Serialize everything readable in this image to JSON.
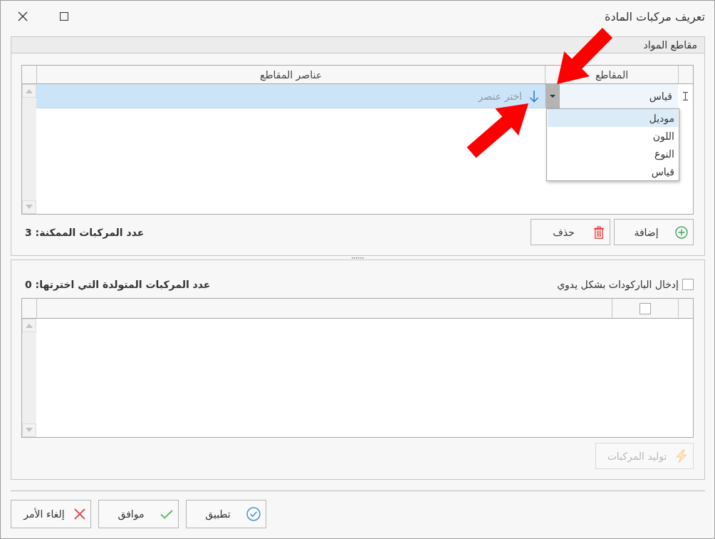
{
  "window": {
    "title": "تعريف مركبات المادة"
  },
  "segments_group": {
    "title": "مقاطع المواد",
    "table": {
      "columns": [
        "المقاطع",
        "عناصر المقاطع"
      ],
      "rows": [
        {
          "segment": "قياس",
          "elements": {
            "placeholder": "اختر عنصر"
          },
          "selected": true
        }
      ]
    },
    "segment_dropdown": {
      "items": [
        {
          "label": "موديل",
          "selected": true
        },
        {
          "label": "اللون",
          "selected": false
        },
        {
          "label": "النوع",
          "selected": false
        },
        {
          "label": "قياس",
          "selected": false
        }
      ]
    },
    "count_label": "عدد المركبات الممكنة: 3",
    "buttons": [
      {
        "label": "إضافة",
        "kind": "add"
      },
      {
        "label": "حذف",
        "kind": "delete"
      }
    ]
  },
  "combinations_group": {
    "manual_barcodes": {
      "label": "إدخال الباركودات بشكل يدوي",
      "checked": false
    },
    "count_label": "عدد المركبات المتولدة التي اخترتها: 0",
    "table": {
      "header_checkbox": {
        "checked": false
      }
    },
    "generate_button": {
      "label": "توليد المركبات",
      "disabled": true
    }
  },
  "footer_buttons": [
    {
      "label": "تطبيق",
      "kind": "apply"
    },
    {
      "label": "موافق",
      "kind": "ok"
    },
    {
      "label": "إلغاء الأمر",
      "kind": "cancel"
    }
  ]
}
